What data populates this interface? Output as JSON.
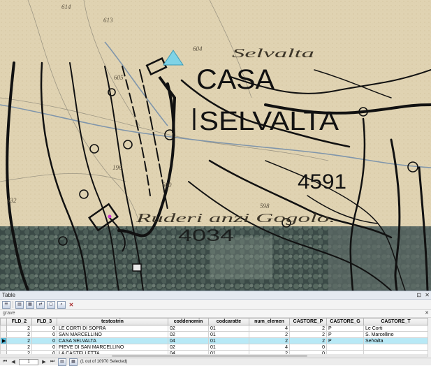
{
  "map": {
    "label_casa": "CASA",
    "label_selvalta": "SELVALTA",
    "label_4591": "4591",
    "label_4034": "4034",
    "hand_selvalta": "Selvalta",
    "hand_ruderi": "Ruderi anzi Gogolo.",
    "cadastral_labels": [
      "614",
      "613",
      "604",
      "605",
      "196",
      "600",
      "598",
      "632"
    ]
  },
  "panel": {
    "title": "Table",
    "controls": [
      "⊡",
      "✕"
    ],
    "layer_name": "grave",
    "layer_close": "✕"
  },
  "table": {
    "columns": [
      "FLD_2",
      "FLD_3",
      "testostrin",
      "coddenomin",
      "codcaratte",
      "num_elemen",
      "CASTORE_P",
      "CASTORE_G",
      "CASTORE_T"
    ],
    "rows": [
      {
        "sel": "",
        "cells": [
          "2",
          "0",
          "LE CORTI DI SOPRA",
          "02",
          "01",
          "4",
          "2",
          "P",
          "Le Corti"
        ]
      },
      {
        "sel": "",
        "cells": [
          "2",
          "0",
          "SAN MARCELLINO",
          "02",
          "01",
          "2",
          "2",
          "P",
          "S. Marcellino"
        ]
      },
      {
        "sel": "▶",
        "cells": [
          "2",
          "0",
          "CASA SELVALTA",
          "04",
          "01",
          "2",
          "2",
          "P",
          "SelValta"
        ]
      },
      {
        "sel": "",
        "cells": [
          "2",
          "0",
          "PIEVE DI SAN MARCELLINO",
          "02",
          "01",
          "4",
          "0",
          "",
          ""
        ]
      },
      {
        "sel": "",
        "cells": [
          "2",
          "0",
          "LA CASTELLETTA",
          "04",
          "01",
          "2",
          "0",
          "",
          ""
        ]
      }
    ]
  },
  "status": {
    "record": "1",
    "selected_text": "(1 out of 10970 Selected)"
  },
  "colors": {
    "highlight_row": "#b8e9f6",
    "marker_triangle": "#7fd3e6"
  }
}
